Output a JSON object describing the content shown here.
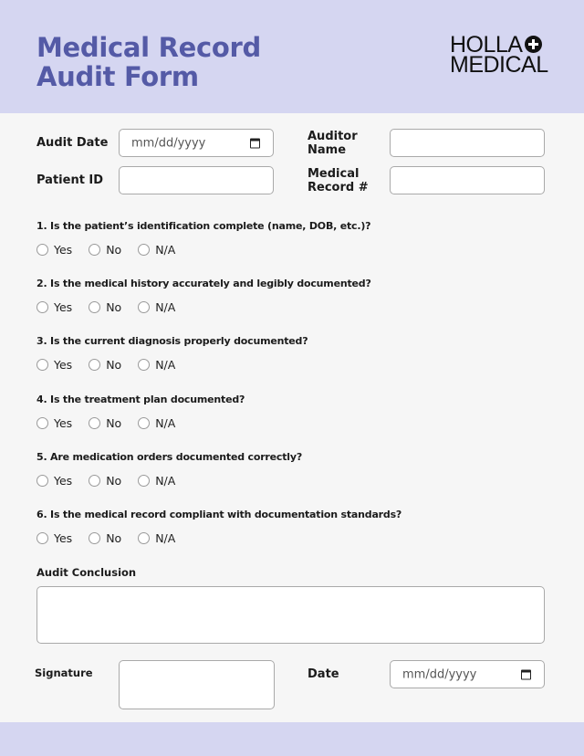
{
  "header": {
    "title_line1": "Medical Record",
    "title_line2": "Audit Form",
    "logo_line1": "HOLLA",
    "logo_line2": "MEDICAL",
    "logo_icon": "plus-circle-icon",
    "bg_color": "#d5d6f1",
    "title_color": "#545aa6"
  },
  "fields": {
    "audit_date": {
      "label": "Audit Date",
      "placeholder": "mm/dd/yyyy"
    },
    "auditor_name": {
      "label_line1": "Auditor",
      "label_line2": "Name",
      "value": ""
    },
    "patient_id": {
      "label": "Patient ID",
      "value": ""
    },
    "medical_record": {
      "label_line1": "Medical",
      "label_line2": "Record #",
      "value": ""
    }
  },
  "questions": [
    {
      "text": "1. Is the patient’s identification complete (name, DOB, etc.)?",
      "options": [
        "Yes",
        "No",
        "N/A"
      ]
    },
    {
      "text": "2. Is the medical history accurately and legibly documented?",
      "options": [
        "Yes",
        "No",
        "N/A"
      ]
    },
    {
      "text": "3. Is the current diagnosis properly documented?",
      "options": [
        "Yes",
        "No",
        "N/A"
      ]
    },
    {
      "text": "4. Is the treatment plan documented?",
      "options": [
        "Yes",
        "No",
        "N/A"
      ]
    },
    {
      "text": "5. Are medication orders documented correctly?",
      "options": [
        "Yes",
        "No",
        "N/A"
      ]
    },
    {
      "text": "6. Is the medical record compliant with documentation standards?",
      "options": [
        "Yes",
        "No",
        "N/A"
      ]
    }
  ],
  "conclusion": {
    "label": "Audit Conclusion",
    "value": ""
  },
  "signature": {
    "label": "Signature"
  },
  "date": {
    "label": "Date",
    "placeholder": "mm/dd/yyyy"
  }
}
